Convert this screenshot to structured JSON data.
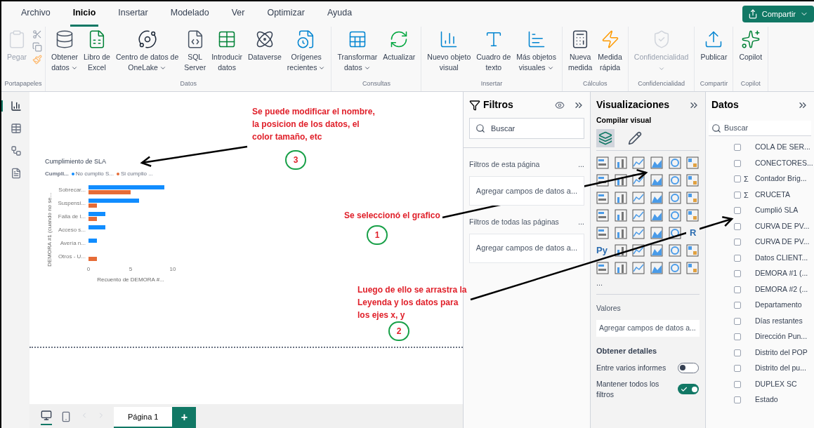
{
  "menu_tabs": [
    {
      "label": "Archivo",
      "selected": false
    },
    {
      "label": "Inicio",
      "selected": true
    },
    {
      "label": "Insertar",
      "selected": false
    },
    {
      "label": "Modelado",
      "selected": false
    },
    {
      "label": "Ver",
      "selected": false
    },
    {
      "label": "Optimizar",
      "selected": false
    },
    {
      "label": "Ayuda",
      "selected": false
    }
  ],
  "share_button": "Compartir",
  "ribbon": [
    {
      "label": "Portapapeles",
      "buttons": [
        {
          "lines": [
            "Pegar"
          ],
          "dropdown": false,
          "disabled": true
        }
      ]
    },
    {
      "label": "Datos",
      "buttons": [
        {
          "lines": [
            "Obtener",
            "datos"
          ],
          "dropdown": true,
          "disabled": false
        },
        {
          "lines": [
            "Libro de",
            "Excel"
          ],
          "dropdown": false,
          "disabled": false
        },
        {
          "lines": [
            "Centro de datos de",
            "OneLake"
          ],
          "dropdown": true,
          "disabled": false
        },
        {
          "lines": [
            "SQL",
            "Server"
          ],
          "dropdown": false,
          "disabled": false
        },
        {
          "lines": [
            "Introducir",
            "datos"
          ],
          "dropdown": false,
          "disabled": false
        },
        {
          "lines": [
            "Dataverse"
          ],
          "dropdown": false,
          "disabled": false
        },
        {
          "lines": [
            "Orígenes",
            "recientes"
          ],
          "dropdown": true,
          "disabled": false
        }
      ]
    },
    {
      "label": "Consultas",
      "buttons": [
        {
          "lines": [
            "Transformar",
            "datos"
          ],
          "dropdown": true,
          "disabled": false
        },
        {
          "lines": [
            "Actualizar"
          ],
          "dropdown": false,
          "disabled": false
        }
      ]
    },
    {
      "label": "Insertar",
      "buttons": [
        {
          "lines": [
            "Nuevo objeto",
            "visual"
          ],
          "dropdown": false,
          "disabled": false
        },
        {
          "lines": [
            "Cuadro de",
            "texto"
          ],
          "dropdown": false,
          "disabled": false
        },
        {
          "lines": [
            "Más objetos",
            "visuales"
          ],
          "dropdown": true,
          "disabled": false
        }
      ]
    },
    {
      "label": "Cálculos",
      "buttons": [
        {
          "lines": [
            "Nueva",
            "medida"
          ],
          "dropdown": false,
          "disabled": false
        },
        {
          "lines": [
            "Medida",
            "rápida"
          ],
          "dropdown": false,
          "disabled": false
        }
      ]
    },
    {
      "label": "Confidencialidad",
      "buttons": [
        {
          "lines": [
            "Confidencialidad"
          ],
          "dropdown": true,
          "disabled": true
        }
      ]
    },
    {
      "label": "Compartir",
      "buttons": [
        {
          "lines": [
            "Publicar"
          ],
          "dropdown": false,
          "disabled": false
        }
      ]
    },
    {
      "label": "Copilot",
      "buttons": [
        {
          "lines": [
            "Copilot"
          ],
          "dropdown": false,
          "disabled": false
        }
      ]
    }
  ],
  "view_rail": [
    {
      "selected": true
    },
    {
      "selected": false
    },
    {
      "selected": false
    },
    {
      "selected": false
    }
  ],
  "visual": {
    "title": "Cumplimiento de SLA",
    "legend_title": "Cumpli...",
    "chart_data": {
      "type": "bar",
      "orientation": "horizontal",
      "xlabel": "Recuento de DEMORA #...",
      "ylabel": "DEMORA #1 (cuando no se...",
      "categories": [
        "Sobrecar...",
        "Suspensi...",
        "Falla de l...",
        "Acceso s...",
        "Avería n...",
        "Otros - U..."
      ],
      "xlim": [
        0,
        10
      ],
      "xticks": [
        0,
        5,
        10
      ],
      "series": [
        {
          "name": "No cumplio S...",
          "color": "#118dff",
          "values": [
            9,
            6,
            2,
            2,
            1,
            null
          ]
        },
        {
          "name": "Si cumplio ...",
          "color": "#e66c37",
          "values": [
            5,
            1,
            1,
            null,
            null,
            1
          ]
        }
      ]
    }
  },
  "annotations": [
    {
      "text": "Se puede modificar el nombre, la posicion de los datos, el color tamaño, etc",
      "number": "3"
    },
    {
      "text": "Se seleccionó el grafico",
      "number": "1"
    },
    {
      "text": "Luego de ello se arrastra la Leyenda y los datos para los ejes x, y",
      "number": "2"
    }
  ],
  "page_tabs": [
    {
      "label": "Página 1",
      "selected": true
    }
  ],
  "add_page": "+",
  "filters": {
    "title": "Filtros",
    "search_placeholder": "Buscar",
    "sections": [
      {
        "title": "Filtros de esta página",
        "more": "...",
        "drop": "Agregar campos de datos a..."
      },
      {
        "title": "Filtros de todas las páginas",
        "more": "...",
        "drop": "Agregar campos de datos a..."
      }
    ]
  },
  "visualizations": {
    "title": "Visualizaciones",
    "subtitle": "Compilar visual",
    "build_tabs": [
      {
        "selected": true
      },
      {
        "selected": false
      }
    ],
    "letters": [
      "R",
      "Py"
    ],
    "more": "...",
    "values_label": "Valores",
    "values_drop": "Agregar campos de datos a...",
    "details_title": "Obtener detalles",
    "toggles": [
      {
        "label": "Entre varios informes",
        "on": false
      },
      {
        "label": "Mantener todos los filtros",
        "on": true
      }
    ]
  },
  "data": {
    "title": "Datos",
    "search_placeholder": "Buscar",
    "fields": [
      {
        "label": "COLA DE SER...",
        "checked": false
      },
      {
        "label": "CONECTORES...",
        "checked": false
      },
      {
        "label": "Contador Brig...",
        "prefix": "Σ",
        "checked": false
      },
      {
        "label": "CRUCETA",
        "prefix": "Σ",
        "checked": false
      },
      {
        "label": "Cumplió SLA",
        "checked": false
      },
      {
        "label": "CURVA DE PV...",
        "checked": false
      },
      {
        "label": "CURVA DE PV...",
        "checked": false
      },
      {
        "label": "Datos CLIENT...",
        "checked": false
      },
      {
        "label": "DEMORA #1 (...",
        "checked": false
      },
      {
        "label": "DEMORA #2 (...",
        "checked": false
      },
      {
        "label": "Departamento",
        "checked": false
      },
      {
        "label": "Días restantes",
        "checked": false
      },
      {
        "label": "Dirección Pun...",
        "checked": false
      },
      {
        "label": "Distrito del POP",
        "checked": false
      },
      {
        "label": "Distrito del pu...",
        "checked": false
      },
      {
        "label": "DUPLEX SC",
        "checked": false
      },
      {
        "label": "Estado",
        "checked": false
      }
    ]
  }
}
